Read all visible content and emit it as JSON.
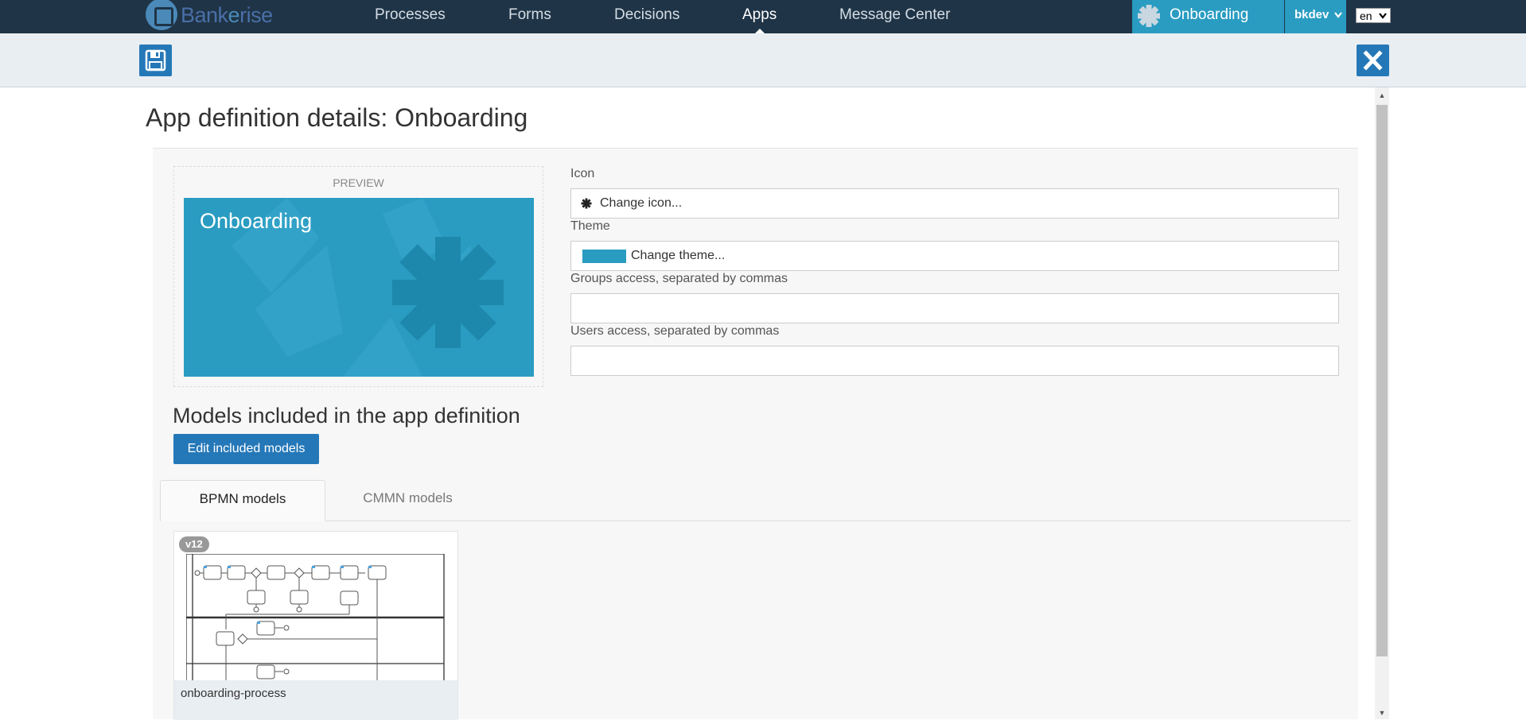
{
  "brand": {
    "name_pre": "Bank",
    "name_hl": "e",
    "name_post": "rise"
  },
  "nav": {
    "items": [
      {
        "label": "Processes"
      },
      {
        "label": "Forms"
      },
      {
        "label": "Decisions"
      },
      {
        "label": "Apps",
        "active": true
      },
      {
        "label": "Message Center"
      }
    ],
    "app_switcher": "Onboarding",
    "user": "bkdev",
    "language": "en"
  },
  "toolbar": {
    "save_icon": "floppy-disk-icon",
    "close_icon": "close-icon"
  },
  "page": {
    "title": "App definition details: Onboarding",
    "preview_label": "PREVIEW",
    "tile_title": "Onboarding",
    "theme_color": "#2a9cc2",
    "accent_color": "#2578b8"
  },
  "form": {
    "icon_label": "Icon",
    "icon_value": "Change icon...",
    "theme_label": "Theme",
    "theme_value": "Change theme...",
    "groups_label": "Groups access, separated by commas",
    "groups_value": "",
    "users_label": "Users access, separated by commas",
    "users_value": ""
  },
  "models": {
    "heading": "Models included in the app definition",
    "edit_button": "Edit included models",
    "tabs": [
      {
        "label": "BPMN models",
        "active": true
      },
      {
        "label": "CMMN models",
        "active": false
      }
    ],
    "cards": [
      {
        "version": "v12",
        "name": "onboarding-process"
      }
    ]
  }
}
